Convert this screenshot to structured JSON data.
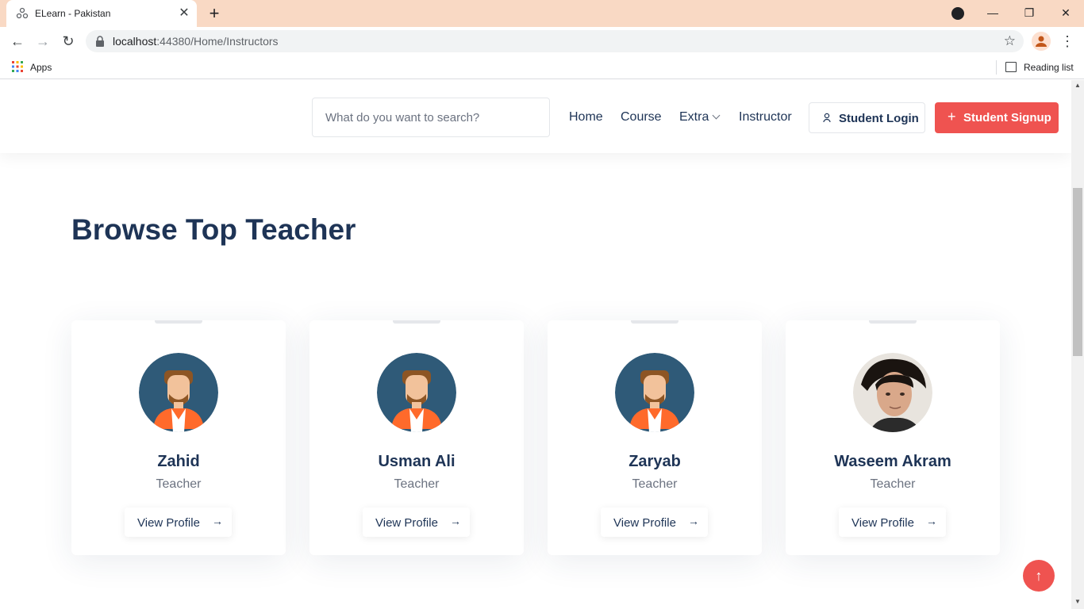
{
  "browser": {
    "tab_title": "ELearn - Pakistan",
    "tab_close": "✕",
    "new_tab": "+",
    "window_minimize": "—",
    "window_restore": "❐",
    "window_close": "✕",
    "back": "←",
    "forward": "→",
    "reload": "↻",
    "url_host": "localhost",
    "url_rest": ":44380/Home/Instructors",
    "star": "☆",
    "menu": "⋮",
    "bookmarks_apps": "Apps",
    "reading_list": "Reading list"
  },
  "header": {
    "search_placeholder": "What do you want to search?",
    "nav": [
      "Home",
      "Course",
      "Extra",
      "Instructor"
    ],
    "login_label": "Student Login",
    "signup_plus": "+",
    "signup_label": "Student Signup"
  },
  "main": {
    "title": "Browse Top Teacher",
    "teachers": [
      {
        "name": "Zahid",
        "role": "Teacher",
        "button": "View Profile",
        "avatar": "illustrated-man-avatar"
      },
      {
        "name": "Usman Ali",
        "role": "Teacher",
        "button": "View Profile",
        "avatar": "illustrated-man-avatar"
      },
      {
        "name": "Zaryab",
        "role": "Teacher",
        "button": "View Profile",
        "avatar": "illustrated-man-avatar"
      },
      {
        "name": "Waseem Akram",
        "role": "Teacher",
        "button": "View Profile",
        "avatar": "photo-avatar"
      }
    ],
    "arrow": "→",
    "back_to_top": "↑"
  },
  "colors": {
    "accent": "#ef5350",
    "heading": "#1e3456",
    "muted": "#6b7280",
    "tabstrip": "#f9d9c4",
    "avatar_bg": "#2f5a78"
  }
}
